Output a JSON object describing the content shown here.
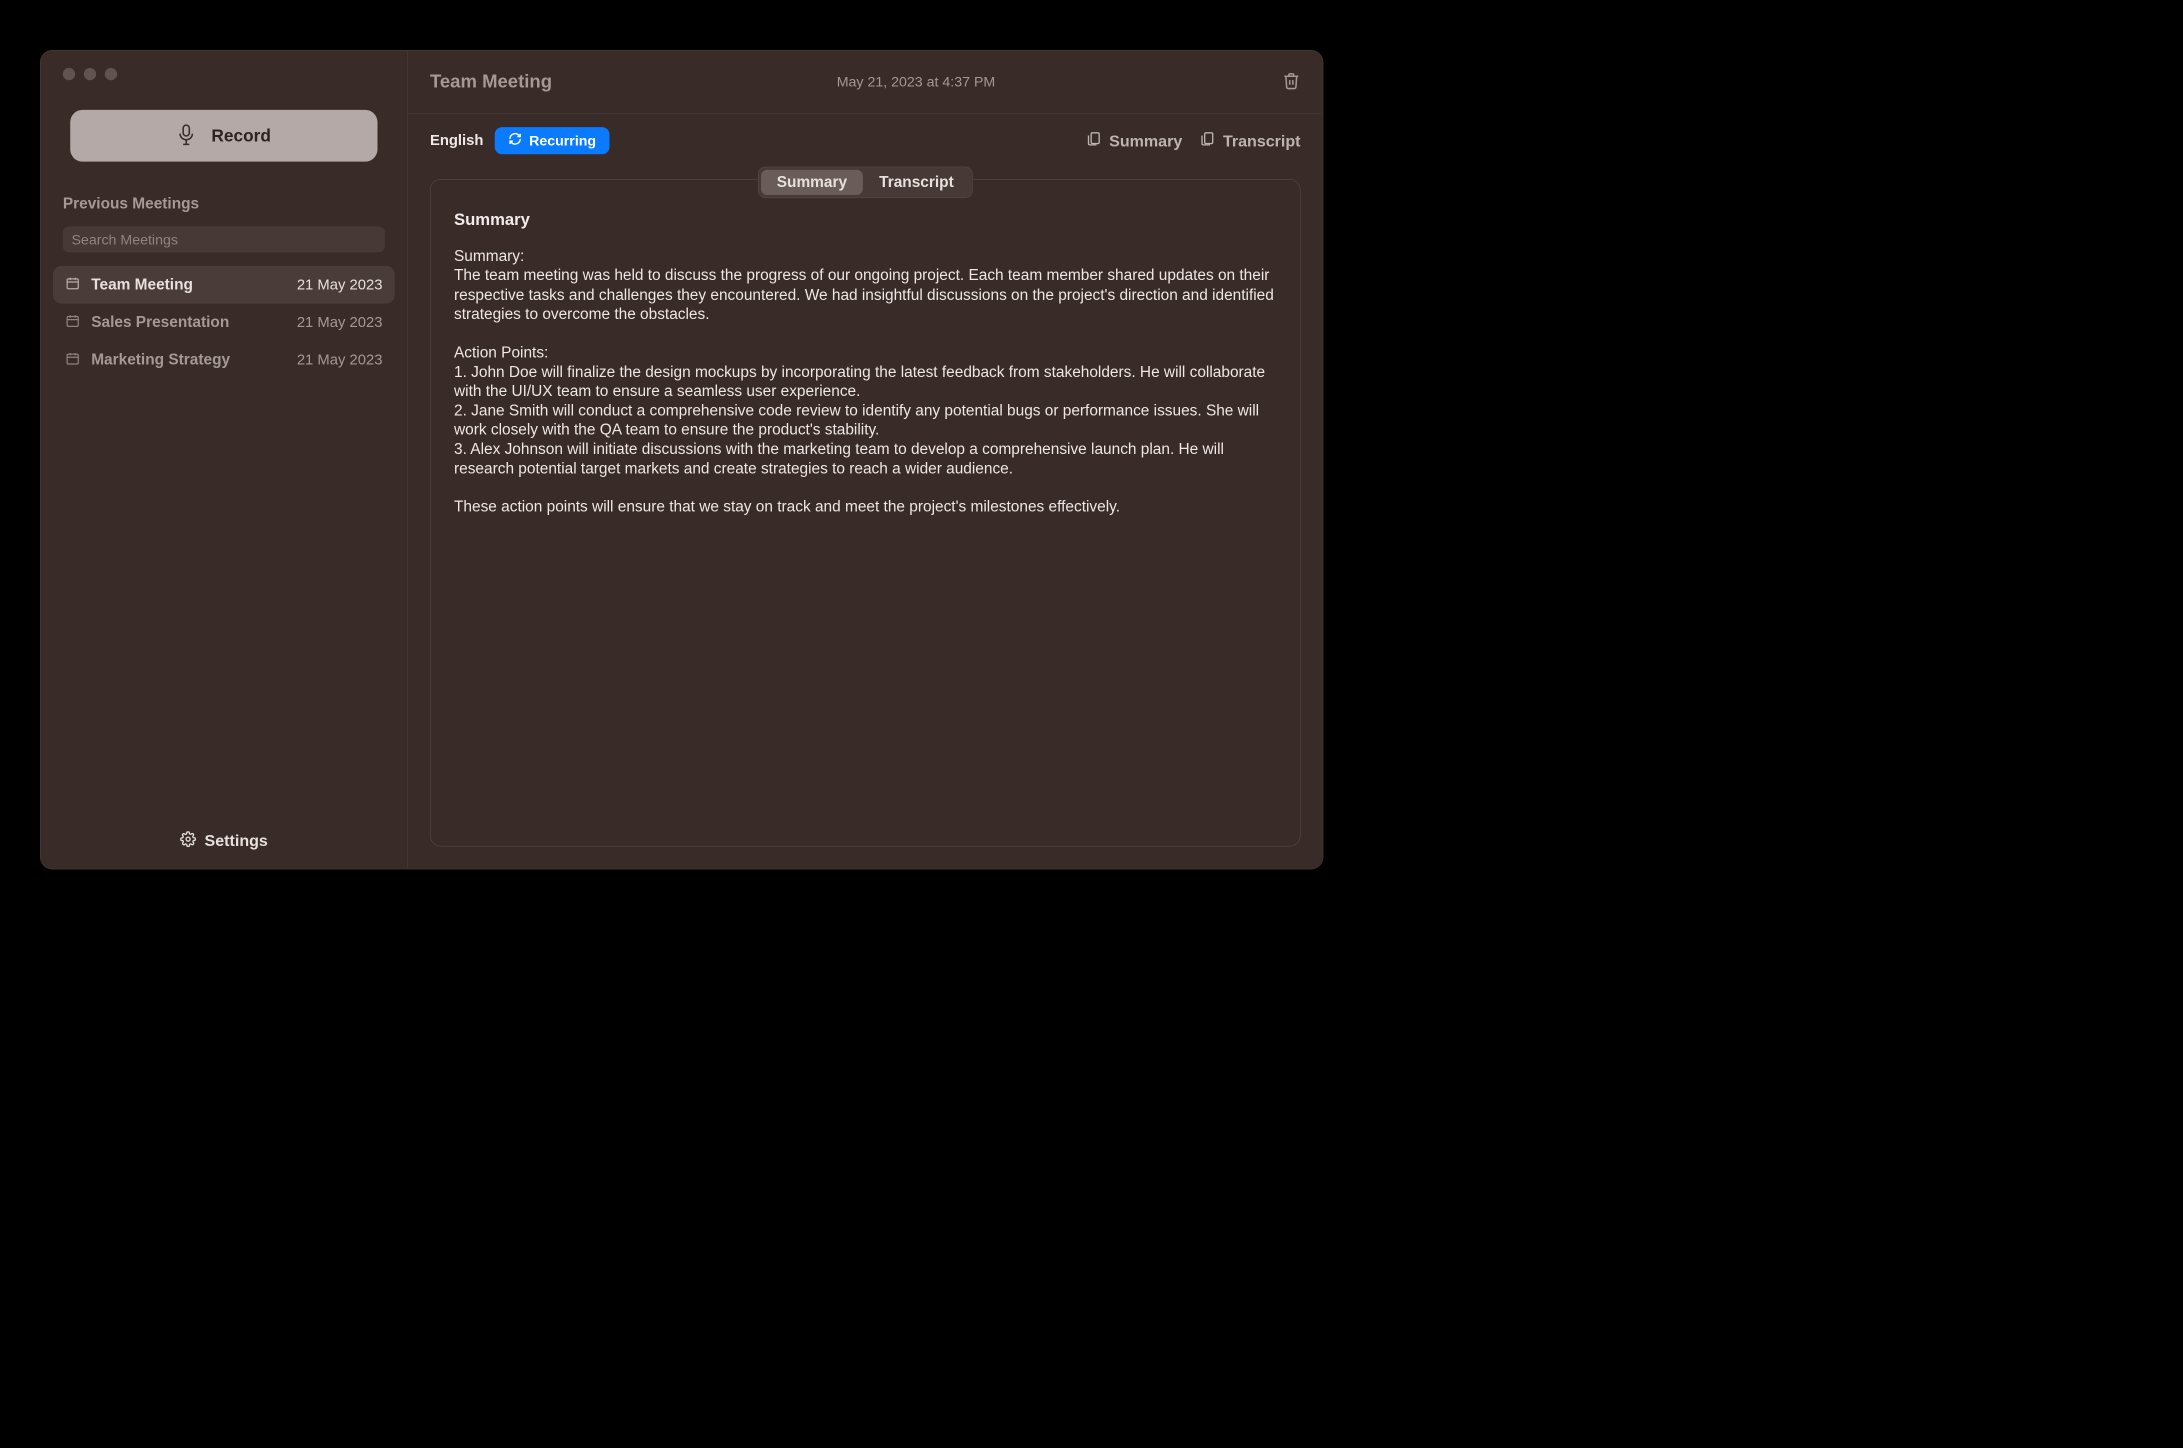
{
  "sidebar": {
    "record_label": "Record",
    "heading": "Previous Meetings",
    "search_placeholder": "Search Meetings",
    "settings_label": "Settings",
    "meetings": [
      {
        "title": "Team Meeting",
        "date": "21 May 2023",
        "selected": true
      },
      {
        "title": "Sales Presentation",
        "date": "21 May 2023",
        "selected": false
      },
      {
        "title": "Marketing Strategy",
        "date": "21 May 2023",
        "selected": false
      }
    ]
  },
  "header": {
    "title": "Team Meeting",
    "timestamp": "May 21, 2023 at 4:37 PM"
  },
  "meta": {
    "language": "English",
    "recurring_label": "Recurring",
    "copy_summary_label": "Summary",
    "copy_transcript_label": "Transcript"
  },
  "tabs": {
    "summary": "Summary",
    "transcript": "Transcript",
    "active": "summary"
  },
  "content": {
    "heading": "Summary",
    "body": "Summary:\nThe team meeting was held to discuss the progress of our ongoing project. Each team member shared updates on their respective tasks and challenges they encountered. We had insightful discussions on the project's direction and identified strategies to overcome the obstacles.\n\nAction Points:\n1. John Doe will finalize the design mockups by incorporating the latest feedback from stakeholders. He will collaborate with the UI/UX team to ensure a seamless user experience.\n2. Jane Smith will conduct a comprehensive code review to identify any potential bugs or performance issues. She will work closely with the QA team to ensure the product's stability.\n3. Alex Johnson will initiate discussions with the marketing team to develop a comprehensive launch plan. He will research potential target markets and create strategies to reach a wider audience.\n\nThese action points will ensure that we stay on track and meet the project's milestones effectively."
  }
}
